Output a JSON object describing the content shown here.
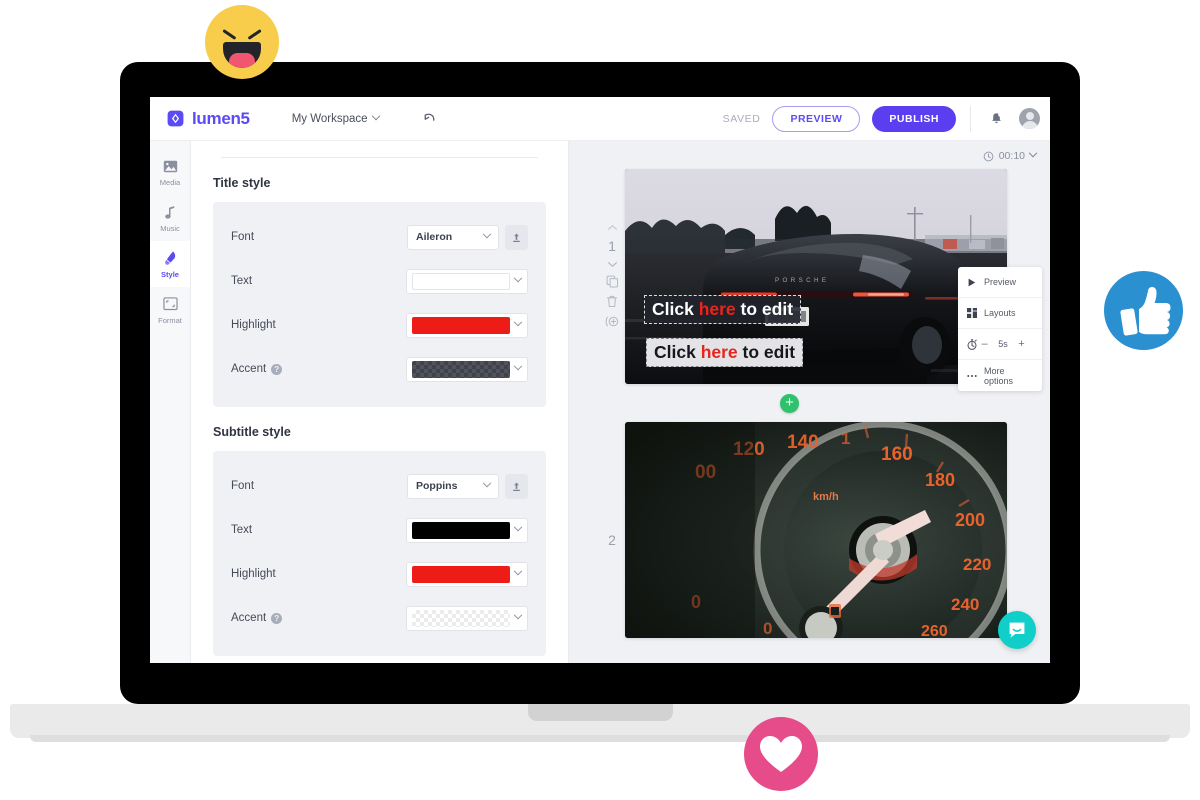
{
  "app": {
    "brand": "lumen5",
    "workspace_label": "My Workspace",
    "undo_icon": "undo-icon",
    "logo_icon": "lumen5-logo-icon"
  },
  "topbar": {
    "saved_label": "SAVED",
    "preview_label": "PREVIEW",
    "publish_label": "PUBLISH",
    "notifications_icon": "bell-icon",
    "avatar_icon": "user-avatar-icon",
    "accent_color": "#5b3ef0"
  },
  "rail": {
    "items": [
      {
        "label": "Media",
        "icon": "image-icon",
        "active": false
      },
      {
        "label": "Music",
        "icon": "music-note-icon",
        "active": false
      },
      {
        "label": "Style",
        "icon": "paint-style-icon",
        "active": true
      },
      {
        "label": "Format",
        "icon": "crop-format-icon",
        "active": false
      }
    ]
  },
  "panel": {
    "sections": [
      {
        "title": "Title style",
        "rows": [
          {
            "label": "Font",
            "type": "font",
            "value": "Aileron",
            "upload_icon": "upload-icon"
          },
          {
            "label": "Text",
            "type": "color",
            "swatch": "#ffffff",
            "style": "solid"
          },
          {
            "label": "Highlight",
            "type": "color",
            "swatch": "#ed1c16",
            "style": "solid"
          },
          {
            "label": "Accent",
            "type": "color",
            "swatch": "#3f424c",
            "style": "checker-dark",
            "help": "?"
          }
        ]
      },
      {
        "title": "Subtitle style",
        "rows": [
          {
            "label": "Font",
            "type": "font",
            "value": "Poppins",
            "upload_icon": "upload-icon"
          },
          {
            "label": "Text",
            "type": "color",
            "swatch": "#000000",
            "style": "solid"
          },
          {
            "label": "Highlight",
            "type": "color",
            "swatch": "#ed1c16",
            "style": "solid"
          },
          {
            "label": "Accent",
            "type": "color",
            "swatch": "#ffffff",
            "style": "checker-light",
            "help": "?"
          }
        ]
      }
    ]
  },
  "canvas": {
    "duration": "00:10",
    "duration_icon": "clock-icon",
    "add_scene_label": "+",
    "scenes": [
      {
        "number": "1",
        "image": "black-porsche-panamera-on-highway",
        "title_text_before": "Click ",
        "title_text_highlight": "here",
        "title_text_after": " to edit",
        "subtitle_text_before": "Click ",
        "subtitle_text_highlight": "here",
        "subtitle_text_after": " to edit"
      },
      {
        "number": "2",
        "image": "car-speedometer-dashboard-km-h"
      }
    ],
    "scene_controls": [
      {
        "name": "move-up",
        "icon": "chevron-up-icon"
      },
      {
        "name": "move-down",
        "icon": "chevron-down-icon"
      },
      {
        "name": "duplicate-scene",
        "icon": "copy-icon"
      },
      {
        "name": "delete-scene",
        "icon": "trash-icon"
      },
      {
        "name": "add-transition",
        "icon": "transition-icon"
      }
    ]
  },
  "context_menu": {
    "items": [
      {
        "label": "Preview",
        "icon": "play-icon"
      },
      {
        "label": "Layouts",
        "icon": "grid-layout-icon"
      },
      {
        "label": "",
        "icon": "stopwatch-icon",
        "type": "stepper",
        "minus": "–",
        "value": "5s",
        "plus": "+"
      },
      {
        "label": "More options",
        "icon": "ellipsis-icon"
      }
    ]
  },
  "intercom": {
    "icon": "chat-bubble-smile-icon",
    "color": "#10cfc9"
  },
  "badges": [
    {
      "name": "reaction-haha",
      "icon": "laughing-face-icon",
      "color": "#f7cd4b"
    },
    {
      "name": "reaction-like",
      "icon": "thumbs-up-icon",
      "color": "#2b90d0"
    },
    {
      "name": "reaction-love",
      "icon": "heart-icon",
      "color": "#e64b8a"
    }
  ]
}
